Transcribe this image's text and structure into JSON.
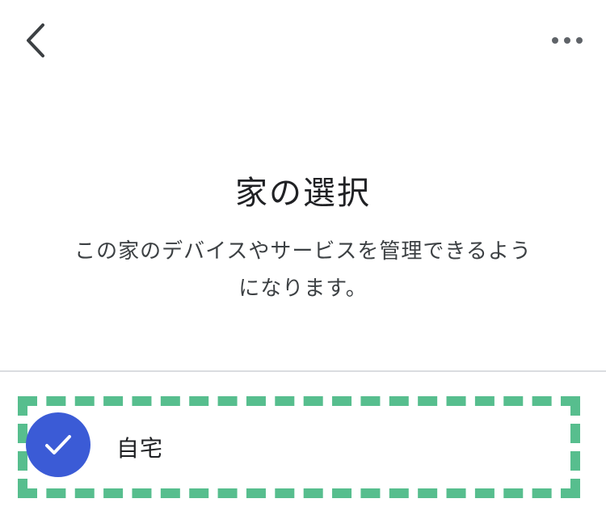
{
  "header": {
    "back_icon": "chevron-left-icon",
    "more_icon": "more-horizontal-icon"
  },
  "main": {
    "title": "家の選択",
    "subtitle_line1": "この家のデバイスやサービスを管理できるよう",
    "subtitle_line2": "になります。"
  },
  "homes": [
    {
      "label": "自宅",
      "selected": true,
      "icon": "check-icon"
    }
  ],
  "colors": {
    "accent": "#3b5bd6",
    "highlight": "#57be8e",
    "divider": "#dadce0",
    "text": "#202124"
  }
}
